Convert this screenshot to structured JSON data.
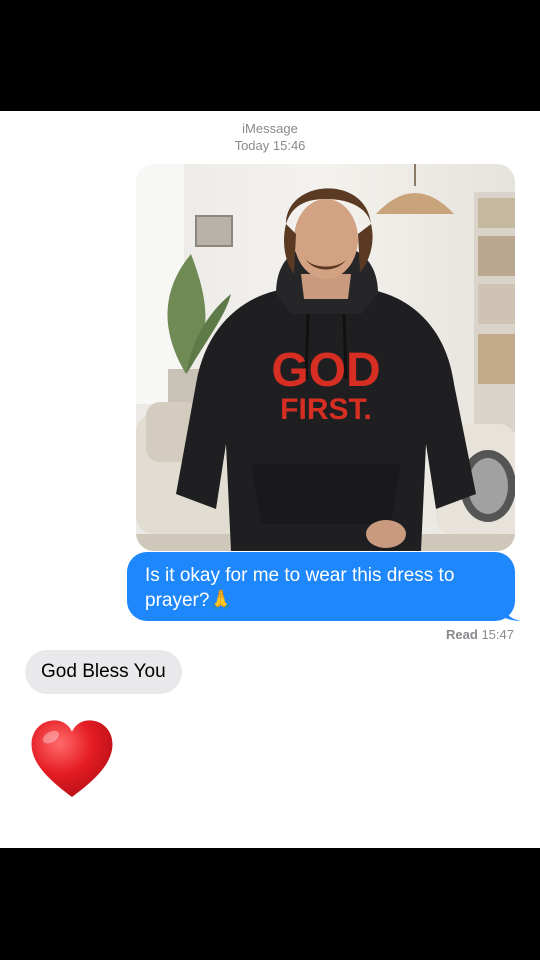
{
  "header": {
    "service": "iMessage",
    "timestamp": "Today 15:46"
  },
  "photo": {
    "shirt_text_line1": "GOD",
    "shirt_text_line2": "FIRST."
  },
  "outgoing": {
    "text": "Is it okay for me to wear this dress to prayer?",
    "emoji": "🙏",
    "color": "#1e87fb"
  },
  "receipt": {
    "label": "Read",
    "time": "15:47"
  },
  "incoming": {
    "text": "God Bless You",
    "emoji": "heart-emoji"
  }
}
